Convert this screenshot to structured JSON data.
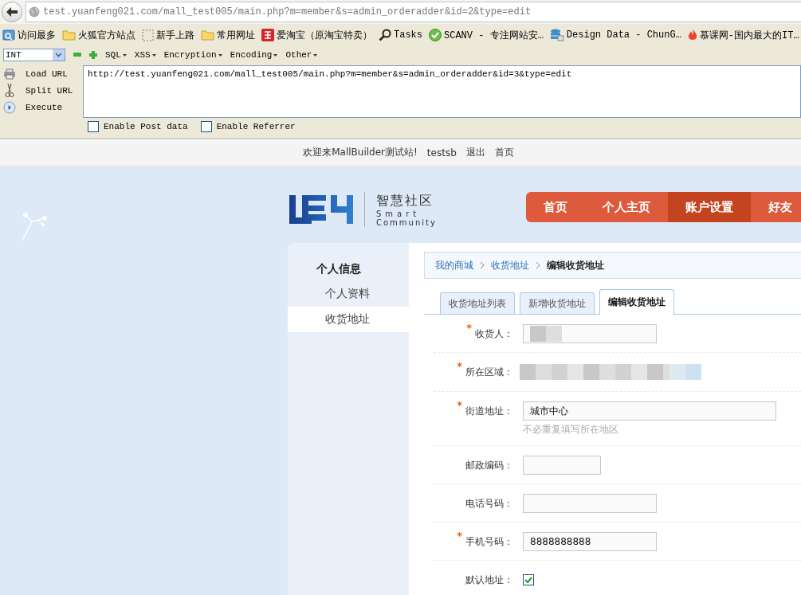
{
  "address_bar": {
    "url": "test.yuanfeng021.com/mall_test005/main.php?m=member&s=admin_orderadder&id=2&type=edit"
  },
  "bookmarks": [
    {
      "label": "访问最多",
      "kind": "page"
    },
    {
      "label": "火狐官方站点",
      "kind": "folder"
    },
    {
      "label": "新手上路",
      "kind": "dashed"
    },
    {
      "label": "常用网址",
      "kind": "folder"
    },
    {
      "label": "爱淘宝（原淘宝特卖）",
      "kind": "tile"
    },
    {
      "label": "Tasks",
      "kind": "magnifier"
    },
    {
      "label": "SCANV - 专注网站安…",
      "kind": "check"
    },
    {
      "label": "Design Data - ChunG…",
      "kind": "stack"
    },
    {
      "label": "慕课网-国内最大的IT…",
      "kind": "flame"
    }
  ],
  "hackbar": {
    "type_select": "INT",
    "menus": [
      "SQL",
      "XSS",
      "Encryption",
      "Encoding",
      "Other"
    ],
    "actions": [
      {
        "label": "Load URL",
        "kind": "load"
      },
      {
        "label": "Split URL",
        "kind": "split"
      },
      {
        "label": "Execute",
        "kind": "execute"
      }
    ],
    "url_text": "http://test.yuanfeng021.com/mall_test005/main.php?m=member&s=admin_orderadder&id=3&type=edit",
    "options": [
      {
        "label": "Enable Post data",
        "checked": false
      },
      {
        "label": "Enable Referrer",
        "checked": false
      }
    ]
  },
  "top_bar": {
    "welcome": "欢迎来MallBuilder测试站!",
    "user": "testsb",
    "links": [
      "退出",
      "首页"
    ]
  },
  "logo": {
    "name": "智慧社区",
    "tagline_1": "Smart",
    "tagline_2": "Community"
  },
  "nav": [
    {
      "label": "首页",
      "selected": false
    },
    {
      "label": "个人主页",
      "selected": false
    },
    {
      "label": "账户设置",
      "selected": true
    },
    {
      "label": "好友",
      "selected": false
    }
  ],
  "sidebar": {
    "heading": "个人信息",
    "items": [
      {
        "label": "个人资料",
        "selected": false
      },
      {
        "label": "收货地址",
        "selected": true
      }
    ]
  },
  "breadcrumb": [
    "我的商城",
    "收货地址",
    "编辑收货地址"
  ],
  "tabs": [
    {
      "label": "收货地址列表",
      "selected": false
    },
    {
      "label": "新增收货地址",
      "selected": false
    },
    {
      "label": "编辑收货地址",
      "selected": true
    }
  ],
  "form": [
    {
      "label": "收货人：",
      "required_mark": "*",
      "kind": "input",
      "redacted": true
    },
    {
      "label": "所在区域：",
      "required_mark": "*",
      "kind": "region",
      "redacted": true
    },
    {
      "label": "街道地址：",
      "required_mark": "*",
      "kind": "input",
      "value": "城市中心",
      "hint": "不必重复填写所在地区"
    },
    {
      "label": "邮政编码：",
      "kind": "input"
    },
    {
      "label": "电话号码：",
      "kind": "input"
    },
    {
      "label": "手机号码：",
      "required_mark": "*",
      "kind": "input",
      "value": "8888888888"
    },
    {
      "label": "默认地址：",
      "kind": "checkbox",
      "checked": true
    }
  ]
}
